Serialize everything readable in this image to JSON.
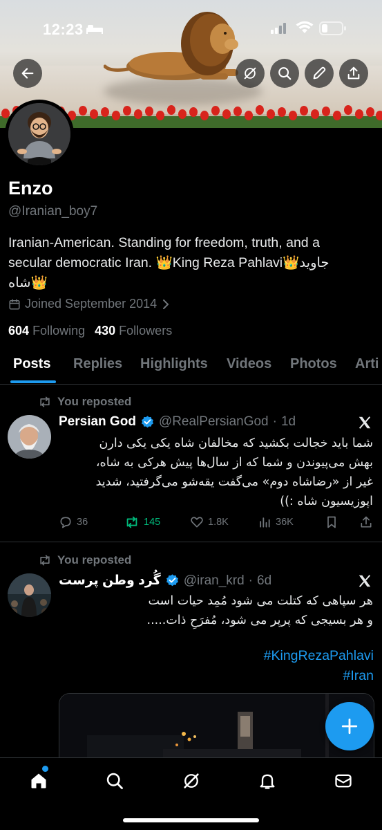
{
  "status_bar": {
    "time": "12:23"
  },
  "profile": {
    "name": "Enzo",
    "handle": "@Iranian_boy7",
    "bio_line1": "Iranian-American. Standing for freedom, truth, and a",
    "bio_line2_a": "secular democratic Iran. ",
    "bio_line2_b": "King Reza Pahlavi",
    "bio_line2_c": "جاوید",
    "bio_line3": "شاه",
    "joined": "Joined September 2014",
    "following_count": "604",
    "following_label": "Following",
    "followers_count": "430",
    "followers_label": "Followers"
  },
  "tabs": [
    "Posts",
    "Replies",
    "Highlights",
    "Videos",
    "Photos",
    "Arti"
  ],
  "posts": [
    {
      "repost_label": "You reposted",
      "name": "Persian God",
      "handle": "@RealPersianGod",
      "time": "1d",
      "lines": [
        "شما باید خجالت بکشید که مخالفان شاه یکی یکی دارن",
        "بهش می‌پیوندن و شما که از سال‌ها پیش هرکی به شاه،",
        "غیر از «رضاشاه دوم» می‌گفت یقه‌شو می‌گرفتید، شدید",
        "اپوزیسیون شاه :))"
      ],
      "replies": "36",
      "reposts": "145",
      "likes": "1.8K",
      "views": "36K"
    },
    {
      "repost_label": "You reposted",
      "name": "گُرد وطن پرست",
      "handle": "@iran_krd",
      "time": "6d",
      "lines": [
        "هر سپاهی که کتلت می شود مُمِد حیات است",
        "و هر بسیجی که پرپر می شود، مُفرَحِ ذات....."
      ],
      "hashtags": [
        "#KingRezaPahlavi",
        "#Iran"
      ]
    }
  ],
  "colors": {
    "accent": "#1d9bf0",
    "repost_green": "#00ba7c",
    "muted": "#71767b"
  }
}
